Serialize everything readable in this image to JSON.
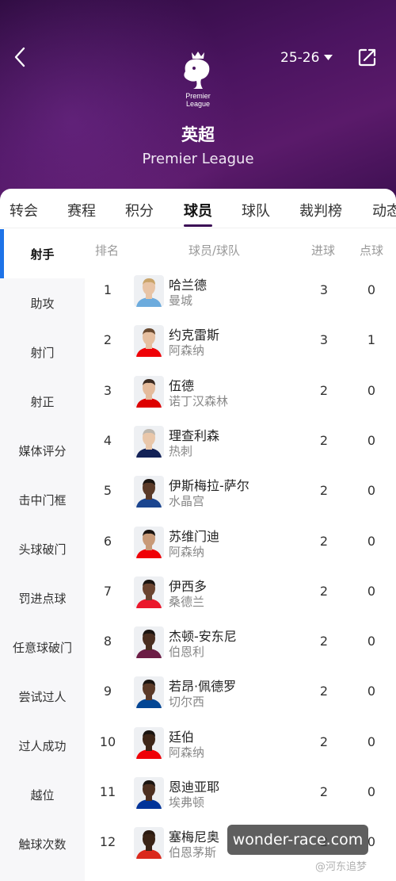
{
  "header": {
    "season": "25-26",
    "league_name_cn": "英超",
    "league_name_en": "Premier League",
    "logo_text_line1": "Premier",
    "logo_text_line2": "League"
  },
  "tabs": [
    "转会",
    "赛程",
    "积分",
    "球员",
    "球队",
    "裁判榜",
    "动态"
  ],
  "active_tab": "球员",
  "sidebar": [
    "射手",
    "助攻",
    "射门",
    "射正",
    "媒体评分",
    "击中门框",
    "头球破门",
    "罚进点球",
    "任意球破门",
    "尝试过人",
    "过人成功",
    "越位",
    "触球次数"
  ],
  "active_sidebar": "射手",
  "columns": {
    "rank": "排名",
    "player": "球员/球队",
    "goals": "进球",
    "pens": "点球"
  },
  "players": [
    {
      "rank": "1",
      "name": "哈兰德",
      "team": "曼城",
      "goals": "3",
      "pens": "0"
    },
    {
      "rank": "2",
      "name": "约克雷斯",
      "team": "阿森纳",
      "goals": "3",
      "pens": "1"
    },
    {
      "rank": "3",
      "name": "伍德",
      "team": "诺丁汉森林",
      "goals": "2",
      "pens": "0"
    },
    {
      "rank": "4",
      "name": "理查利森",
      "team": "热刺",
      "goals": "2",
      "pens": "0"
    },
    {
      "rank": "5",
      "name": "伊斯梅拉-萨尔",
      "team": "水晶宫",
      "goals": "2",
      "pens": "0"
    },
    {
      "rank": "6",
      "name": "苏维门迪",
      "team": "阿森纳",
      "goals": "2",
      "pens": "0"
    },
    {
      "rank": "7",
      "name": "伊西多",
      "team": "桑德兰",
      "goals": "2",
      "pens": "0"
    },
    {
      "rank": "8",
      "name": "杰顿-安东尼",
      "team": "伯恩利",
      "goals": "2",
      "pens": "0"
    },
    {
      "rank": "9",
      "name": "若昂·佩德罗",
      "team": "切尔西",
      "goals": "2",
      "pens": "0"
    },
    {
      "rank": "10",
      "name": "廷伯",
      "team": "阿森纳",
      "goals": "2",
      "pens": "0"
    },
    {
      "rank": "11",
      "name": "恩迪亚耶",
      "team": "埃弗顿",
      "goals": "2",
      "pens": "0"
    },
    {
      "rank": "12",
      "name": "塞梅尼奥",
      "team": "伯恩茅斯",
      "goals": "2",
      "pens": "0"
    }
  ],
  "watermark": "wonder-race.com",
  "watermark_small": "@河东追梦",
  "colors": {
    "header_purple": "#4b1460",
    "accent_blue": "#1e73e8",
    "tab_underline": "#3b0d55"
  }
}
